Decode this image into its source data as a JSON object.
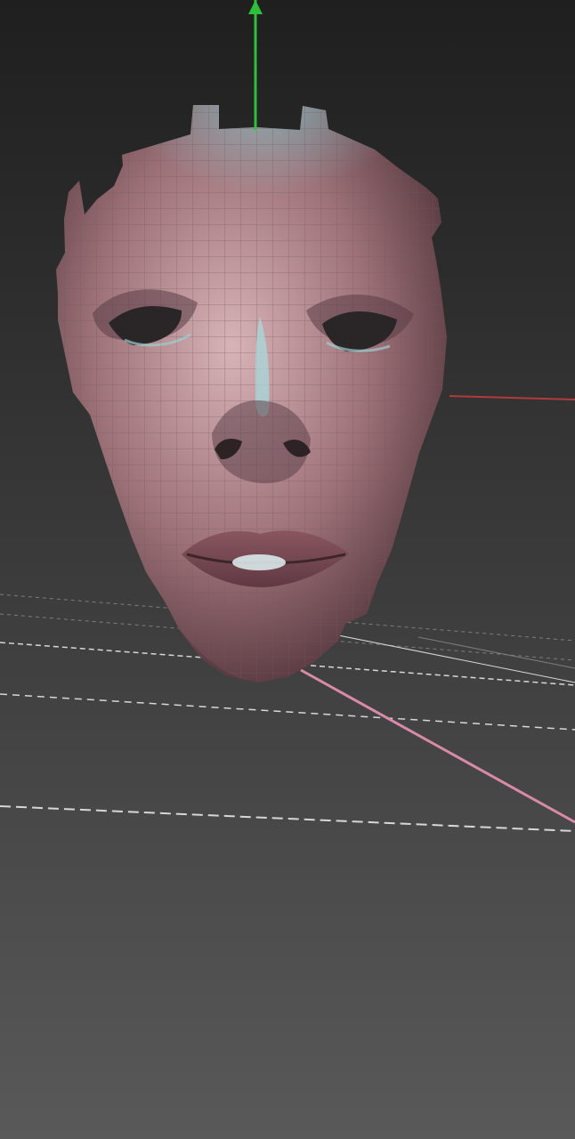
{
  "viewport": {
    "name": "3d-viewport",
    "background_top": "#1f1f1f",
    "background_mid": "#3b3b3b",
    "background_bottom": "#595959"
  },
  "axes": {
    "x_axis_color": "#b33a3a",
    "y_axis_color": "#2fbf3a",
    "z_axis_color": "#d98aa8",
    "grid_major_color": "#d7d7d7",
    "grid_minor_color": "#7d7d7d"
  },
  "model": {
    "name": "face-mesh",
    "skin_light": "#d7b3b7",
    "skin_mid": "#9d7178",
    "skin_dark": "#4c3036",
    "highlight": "#8ad5d8",
    "lip_color": "#8a5660",
    "wire_color": "#6f5a62"
  }
}
